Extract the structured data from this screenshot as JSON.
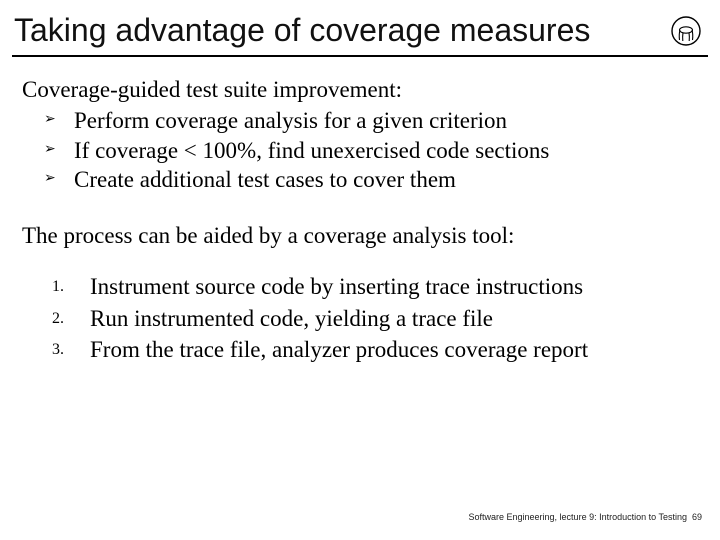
{
  "title": "Taking advantage of coverage measures",
  "icon": "chair-icon",
  "content": {
    "lead1": "Coverage-guided test suite improvement:",
    "bullets": [
      "Perform coverage analysis for a given criterion",
      "If coverage < 100%, find unexercised code sections",
      "Create additional test cases to cover them"
    ],
    "lead2": "The process can be aided by a coverage analysis tool:",
    "steps": [
      {
        "n": "1.",
        "text": "Instrument source code by inserting trace instructions"
      },
      {
        "n": "2.",
        "text": "Run instrumented code, yielding a trace file"
      },
      {
        "n": "3.",
        "text": "From the trace file, analyzer produces coverage report"
      }
    ]
  },
  "footer": "Software Engineering, lecture 9: Introduction to Testing",
  "page_number": "69"
}
